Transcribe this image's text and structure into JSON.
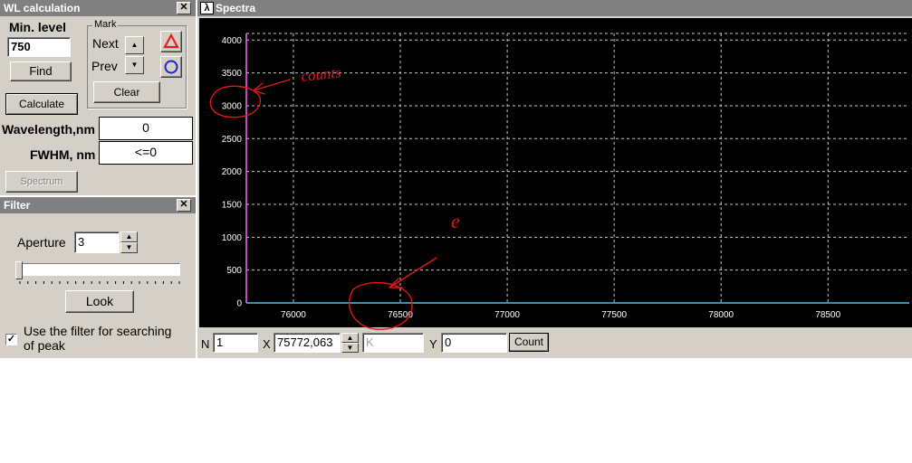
{
  "wl_panel": {
    "title": "WL calculation",
    "min_level_label": "Min. level",
    "min_level_value": "750",
    "find_label": "Find",
    "mark_group_label": "Mark",
    "next_label": "Next",
    "prev_label": "Prev",
    "clear_label": "Clear",
    "calculate_label": "Calculate",
    "wavelength_label": "Wavelength,nm",
    "wavelength_value": "0",
    "fwhm_label": "FWHM, nm",
    "fwhm_value": "<=0",
    "spectrum_label": "Spectrum",
    "triangle_color": "#e02020",
    "circle_color": "#2020d0"
  },
  "filter_panel": {
    "title": "Filter",
    "aperture_label": "Aperture",
    "aperture_value": "3",
    "look_label": "Look",
    "checkbox_label_line1": "Use the filter for searching",
    "checkbox_label_line2": "of peak",
    "checkbox_checked": true,
    "slider_position": 0
  },
  "spectra_window": {
    "title": "Spectra",
    "icon_glyph": "λ",
    "n_label": "N",
    "n_value": "1",
    "x_label": "X",
    "x_value": "75772,063",
    "k_placeholder": "K",
    "y_label": "Y",
    "y_value": "0",
    "count_label": "Count"
  },
  "annotations": {
    "text1": "counts",
    "text2": "e",
    "color": "#e01818"
  },
  "chart_data": {
    "type": "line",
    "title": "",
    "xlabel": "",
    "ylabel": "",
    "xlim": [
      75780,
      78880
    ],
    "ylim": [
      0,
      4100
    ],
    "x_ticks": [
      76000,
      76500,
      77000,
      77500,
      78000,
      78500
    ],
    "y_ticks": [
      0,
      500,
      1000,
      1500,
      2000,
      2500,
      3000,
      3500,
      4000
    ],
    "grid": true,
    "background": "#000000",
    "series": [
      {
        "x": [
          75780,
          78880
        ],
        "y": [
          0,
          0
        ],
        "color": "#40c8f0"
      }
    ]
  }
}
